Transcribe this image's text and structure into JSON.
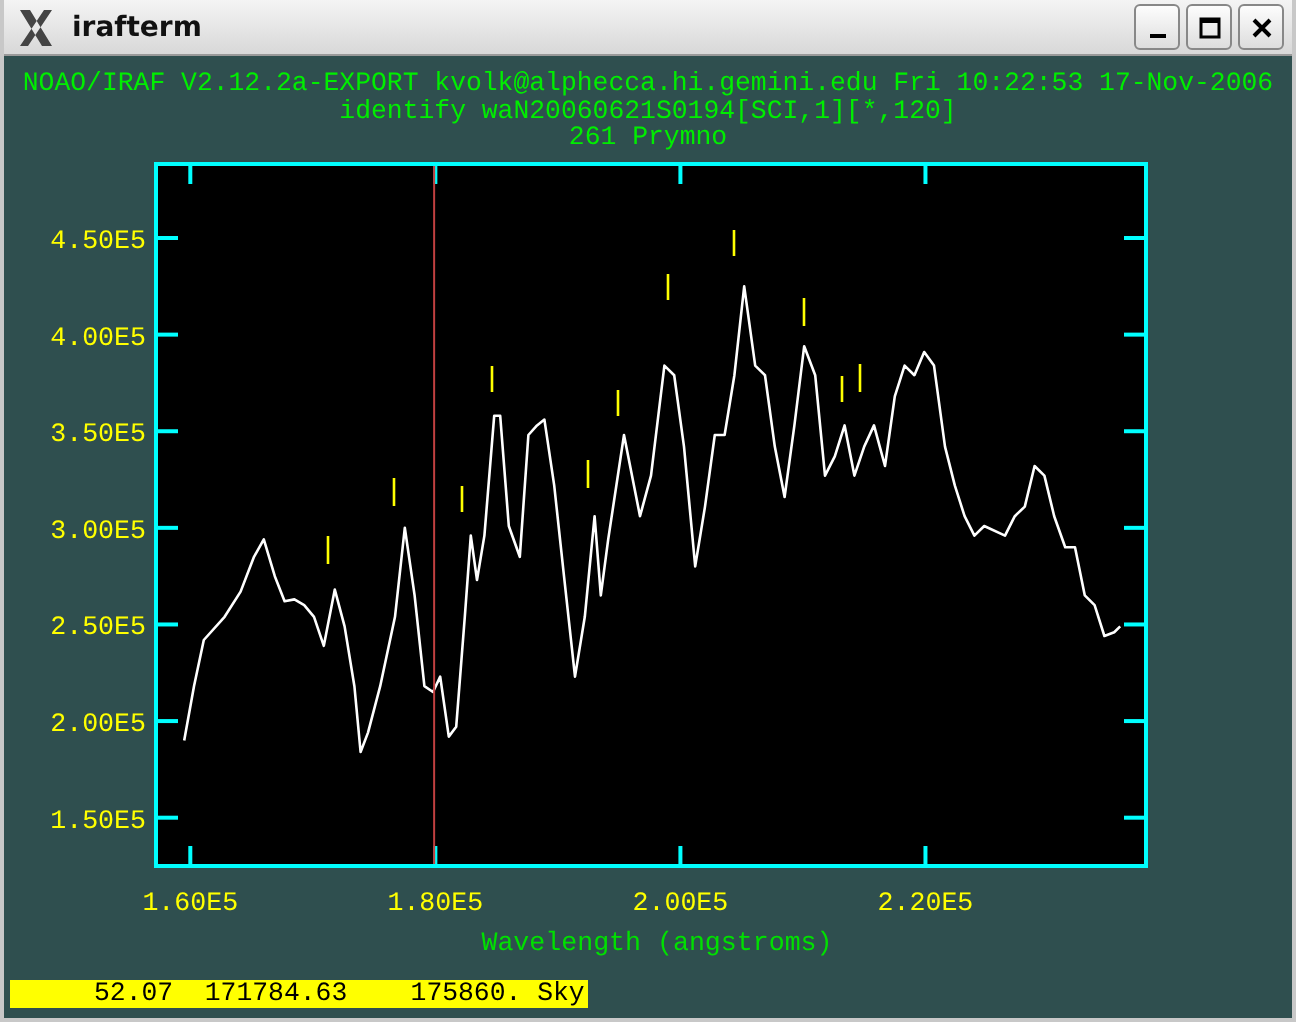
{
  "window": {
    "title": "irafterm"
  },
  "header": [
    "NOAO/IRAF V2.12.2a-EXPORT kvolk@alphecca.hi.gemini.edu Fri 10:22:53 17-Nov-2006",
    "identify waN20060621S0194[SCI,1][*,120]",
    "261 Prymno"
  ],
  "plot": {
    "chart_data": {
      "type": "line",
      "xlabel": "Wavelength (angstroms)",
      "xlim": [
        157200,
        238000
      ],
      "ylim": [
        125000,
        488300
      ],
      "xticks": [
        {
          "value": 160000,
          "label": "1.60E5"
        },
        {
          "value": 180000,
          "label": "1.80E5"
        },
        {
          "value": 200000,
          "label": "2.00E5"
        },
        {
          "value": 220000,
          "label": "2.20E5"
        }
      ],
      "yticks": [
        {
          "value": 150000,
          "label": "1.50E5"
        },
        {
          "value": 200000,
          "label": "2.00E5"
        },
        {
          "value": 250000,
          "label": "2.50E5"
        },
        {
          "value": 300000,
          "label": "3.00E5"
        },
        {
          "value": 350000,
          "label": "3.50E5"
        },
        {
          "value": 400000,
          "label": "4.00E5"
        },
        {
          "value": 450000,
          "label": "4.50E5"
        }
      ],
      "x": [
        159500,
        160300,
        161100,
        162800,
        164100,
        165200,
        166000,
        166900,
        167700,
        168500,
        169300,
        170100,
        170900,
        171800,
        172600,
        173400,
        173900,
        174500,
        175500,
        176700,
        177500,
        178300,
        179100,
        179800,
        180400,
        181100,
        181700,
        182400,
        182900,
        183400,
        184000,
        184800,
        185300,
        186000,
        186900,
        187600,
        188300,
        188900,
        189700,
        190500,
        191400,
        192200,
        193000,
        193500,
        194100,
        195400,
        196700,
        197600,
        198700,
        199500,
        200300,
        201200,
        202000,
        202800,
        203600,
        204400,
        205200,
        206100,
        206900,
        207700,
        208500,
        209300,
        210100,
        211000,
        211800,
        212600,
        213400,
        214200,
        215000,
        215800,
        216700,
        217500,
        218300,
        219100,
        219900,
        220700,
        221600,
        222400,
        223200,
        224000,
        224800,
        226500,
        227300,
        228100,
        228900,
        229700,
        230500,
        231400,
        232200,
        233000,
        233800,
        234600,
        235400,
        235900
      ],
      "series": [
        {
          "color": "#ffffff",
          "values": [
            190000,
            218000,
            242000,
            254000,
            267000,
            285000,
            294000,
            275000,
            262000,
            263000,
            260000,
            254000,
            239000,
            268000,
            249000,
            218000,
            184000,
            194000,
            218000,
            254000,
            300000,
            265000,
            218000,
            215000,
            223000,
            192000,
            197000,
            254000,
            296000,
            273000,
            296000,
            358000,
            358000,
            301000,
            285000,
            348000,
            353000,
            356000,
            322000,
            275000,
            223000,
            254000,
            306000,
            265000,
            294000,
            348000,
            306000,
            327000,
            384000,
            379000,
            342000,
            280000,
            311000,
            348000,
            348000,
            379000,
            425000,
            384000,
            379000,
            342000,
            316000,
            353000,
            394000,
            379000,
            327000,
            337000,
            353000,
            327000,
            342000,
            353000,
            332000,
            368000,
            384000,
            379000,
            391000,
            384000,
            342000,
            322000,
            306000,
            296000,
            301000,
            296000,
            306000,
            311000,
            332000,
            327000,
            306000,
            290000,
            290000,
            265000,
            260000,
            244000,
            246000,
            249000
          ]
        }
      ],
      "ref_lines": [
        {
          "axis": "x",
          "value": 179900,
          "color": "#c04040"
        }
      ]
    }
  },
  "status_bar": "52.07  171784.63    175860. Sky"
}
